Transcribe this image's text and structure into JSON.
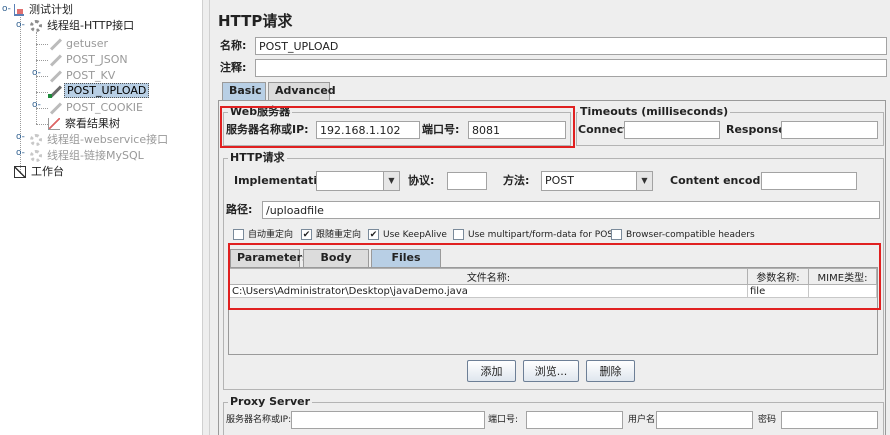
{
  "tree": {
    "test_plan": "测试计划",
    "thread_group": "线程组-HTTP接口",
    "samplers": [
      "getuser",
      "POST_JSON",
      "POST_KV",
      "POST_UPLOAD",
      "POST_COOKIE"
    ],
    "listener": "察看结果树",
    "thread_group_ws": "线程组-webservice接口",
    "thread_group_mysql": "线程组-链接MySQL",
    "workbench": "工作台"
  },
  "panel": {
    "title": "HTTP请求",
    "name_label": "名称:",
    "name_value": "POST_UPLOAD",
    "comment_label": "注释:",
    "comment_value": "",
    "tabs": [
      "Basic",
      "Advanced"
    ],
    "web_server": {
      "legend": "Web服务器",
      "server_label": "服务器名称或IP:",
      "server_value": "192.168.1.102",
      "port_label": "端口号:",
      "port_value": "8081"
    },
    "timeouts": {
      "legend": "Timeouts (milliseconds)",
      "connect_label": "Connect:",
      "connect_value": "",
      "response_label": "Response:",
      "response_value": ""
    },
    "http_request": {
      "legend": "HTTP请求",
      "implementation_label": "Implementation:",
      "implementation_value": "",
      "protocol_label": "协议:",
      "protocol_value": "",
      "method_label": "方法:",
      "method_value": "POST",
      "encoding_label": "Content encoding:",
      "encoding_value": "",
      "path_label": "路径:",
      "path_value": "/uploadfile"
    },
    "checkboxes": [
      {
        "label": "自动重定向",
        "checked": false
      },
      {
        "label": "跟随重定向",
        "checked": true
      },
      {
        "label": "Use KeepAlive",
        "checked": true
      },
      {
        "label": "Use multipart/form-data for POST",
        "checked": false
      },
      {
        "label": "Browser-compatible headers",
        "checked": false
      }
    ],
    "sub_tabs": [
      "Parameters",
      "Body Data",
      "Files Upload"
    ],
    "files_table": {
      "columns": [
        "文件名称:",
        "参数名称:",
        "MIME类型:"
      ],
      "rows": [
        [
          "C:\\Users\\Administrator\\Desktop\\javaDemo.java",
          "file",
          ""
        ]
      ]
    },
    "buttons": {
      "add": "添加",
      "browse": "浏览...",
      "delete": "删除"
    },
    "proxy": {
      "legend": "Proxy Server",
      "server_label": "服务器名称或IP:",
      "port_label": "端口号:",
      "user_label": "用户名",
      "password_label": "密码"
    }
  },
  "colors": {
    "highlight_box": "#e02020",
    "selection": "#b8cfe5"
  }
}
